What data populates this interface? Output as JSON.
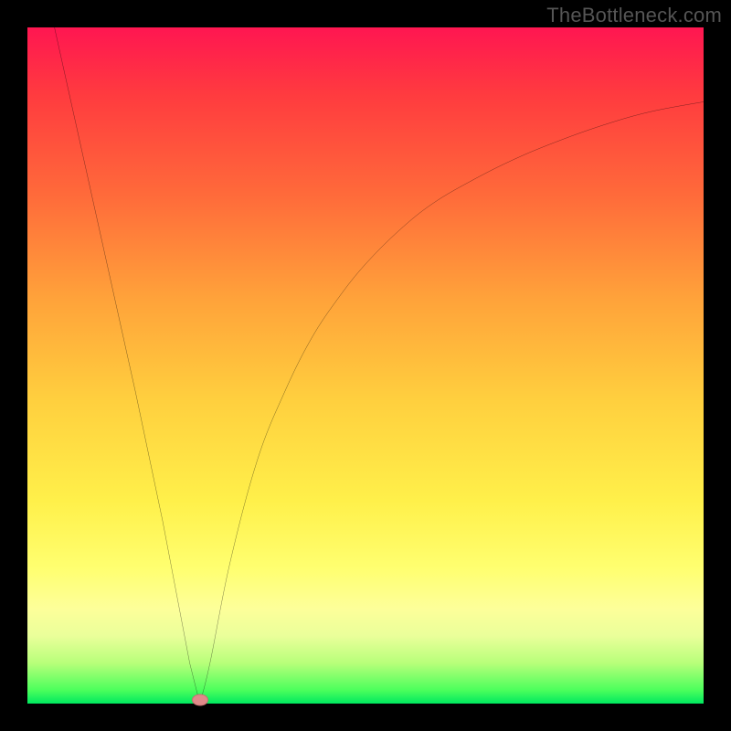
{
  "watermark": "TheBottleneck.com",
  "chart_data": {
    "type": "line",
    "title": "",
    "xlabel": "",
    "ylabel": "",
    "xlim": [
      0,
      100
    ],
    "ylim": [
      0,
      100
    ],
    "grid": false,
    "annotations": [
      {
        "type": "marker",
        "x": 25.5,
        "y": 0.5,
        "color": "#e08a8a"
      }
    ],
    "series": [
      {
        "name": "curve",
        "color": "#000000",
        "x": [
          4,
          8,
          12,
          16,
          20,
          24,
          25.5,
          27,
          30,
          34,
          38,
          42,
          46,
          50,
          55,
          60,
          66,
          72,
          78,
          85,
          92,
          100
        ],
        "y": [
          100,
          82,
          64,
          46,
          27,
          6,
          0,
          6,
          21,
          36,
          46,
          54,
          60,
          65,
          70,
          74,
          77.5,
          80.5,
          83,
          85.5,
          87.5,
          89
        ]
      }
    ],
    "background_gradient": {
      "direction": "top-to-bottom",
      "stops": [
        {
          "pos": 0.0,
          "color": "#ff1651"
        },
        {
          "pos": 0.1,
          "color": "#ff3b3f"
        },
        {
          "pos": 0.25,
          "color": "#ff6b3a"
        },
        {
          "pos": 0.4,
          "color": "#ffa23a"
        },
        {
          "pos": 0.55,
          "color": "#ffcf3e"
        },
        {
          "pos": 0.7,
          "color": "#fff04a"
        },
        {
          "pos": 0.8,
          "color": "#ffff70"
        },
        {
          "pos": 0.86,
          "color": "#fdff9a"
        },
        {
          "pos": 0.9,
          "color": "#eaff9a"
        },
        {
          "pos": 0.94,
          "color": "#b8ff7a"
        },
        {
          "pos": 0.98,
          "color": "#4cff5c"
        },
        {
          "pos": 1.0,
          "color": "#00e85f"
        }
      ]
    }
  }
}
